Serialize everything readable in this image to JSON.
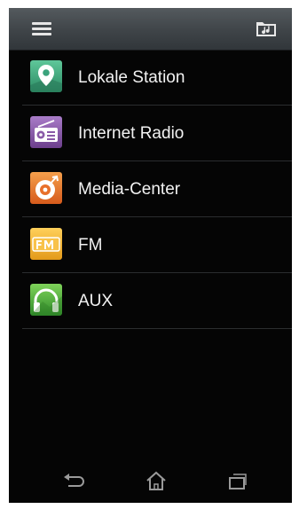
{
  "top_bar": {
    "menu_icon": "hamburger-menu-icon",
    "folder_icon": "folder-music-icon"
  },
  "menu": {
    "items": [
      {
        "label": "Lokale Station",
        "icon": "location-pin-icon",
        "color": "#3aa37c"
      },
      {
        "label": "Internet Radio",
        "icon": "radio-icon",
        "color": "#8a5aa8"
      },
      {
        "label": "Media-Center",
        "icon": "disc-icon",
        "color": "#e8702b"
      },
      {
        "label": "FM",
        "icon": "fm-icon",
        "color": "#f0b22a"
      },
      {
        "label": "AUX",
        "icon": "headphones-icon",
        "color": "#4aa83a"
      }
    ]
  },
  "nav_bar": {
    "back_icon": "back-icon",
    "home_icon": "home-icon",
    "recent_icon": "recent-apps-icon"
  }
}
